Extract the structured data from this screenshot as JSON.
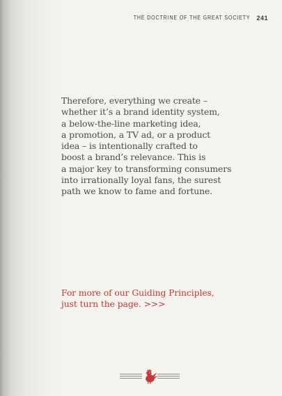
{
  "header": {
    "running_title": "THE DOCTRINE OF THE GREAT SOCIETY",
    "page_number": "241"
  },
  "body": {
    "paragraph": "Therefore, everything we create –\nwhether it’s a brand identity system,\na below-the-line marketing idea,\na promotion, a TV ad, or a product\nidea – is intentionally crafted to\nboost a brand’s relevance. This is\na major key to transforming consumers\ninto irrationally loyal fans, the surest\npath we know to fame and fortune."
  },
  "footer_note": {
    "text": "For more of our Guiding Principles,\njust turn the page. >>>"
  },
  "ornament": {
    "icon": "rooster-emblem-icon",
    "accent_color": "#c6373a",
    "rule_color": "#8c8c88"
  },
  "colors": {
    "background": "#f4f3ed",
    "text": "#4b4a47",
    "accent": "#c6373a"
  }
}
